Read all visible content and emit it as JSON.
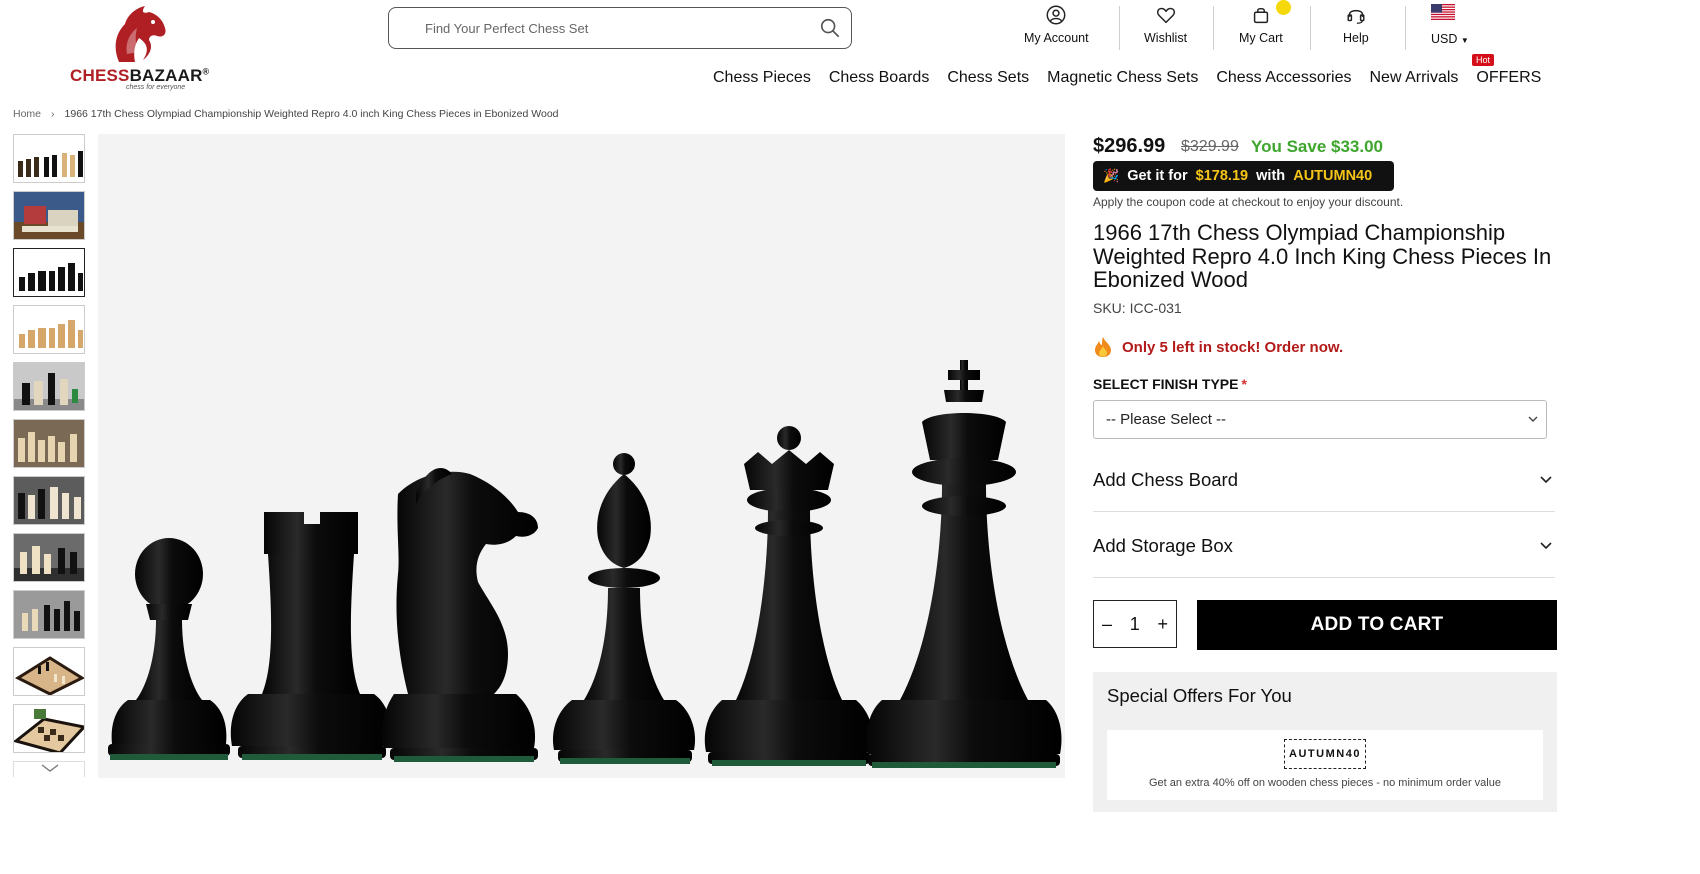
{
  "brand": {
    "name_part1": "CHESS",
    "name_part2": "BAZAAR",
    "registered": "®",
    "tagline": "chess for everyone"
  },
  "search": {
    "placeholder": "Find Your Perfect Chess Set"
  },
  "header_icons": {
    "account": "My Account",
    "wishlist": "Wishlist",
    "cart": "My Cart",
    "help": "Help",
    "currency": "USD"
  },
  "nav": {
    "items": [
      "Chess Pieces",
      "Chess Boards",
      "Chess Sets",
      "Magnetic Chess Sets",
      "Chess Accessories",
      "New Arrivals",
      "OFFERS"
    ],
    "hot_badge": "Hot"
  },
  "breadcrumb": {
    "home": "Home",
    "current": "1966 17th Chess Olympiad Championship Weighted Repro 4.0 inch King Chess Pieces in Ebonized Wood"
  },
  "product": {
    "price": "$296.99",
    "old_price": "$329.99",
    "save_text": "You Save $33.00",
    "coupon": {
      "prefix": "Get it for",
      "discount_price": "$178.19",
      "with_text": "with",
      "code": "AUTUMN40"
    },
    "coupon_note": "Apply the coupon code at checkout to enjoy your discount.",
    "title": "1966 17th Chess Olympiad Championship Weighted Repro 4.0 Inch King Chess Pieces In Ebonized Wood",
    "sku": "SKU: ICC-031",
    "stock": "Only 5 left in stock! Order now.",
    "finish_label": "SELECT FINISH TYPE",
    "required_mark": "*",
    "finish_selected": "-- Please Select --",
    "addons": [
      "Add Chess Board",
      "Add Storage Box"
    ],
    "qty": {
      "minus": "–",
      "value": "1",
      "plus": "+"
    },
    "add_to_cart": "ADD TO CART"
  },
  "offers": {
    "title": "Special Offers For You",
    "code": "AUTUMN40",
    "description": "Get an extra 40% off on wooden chess pieces - no minimum order value"
  },
  "colors": {
    "brand_red": "#b01f24",
    "save_green": "#3ea52d",
    "stock_red": "#b31a1a",
    "coupon_yellow": "#f5c518",
    "cart_dot": "#f5d80a",
    "hot_red": "#d50f1a"
  }
}
